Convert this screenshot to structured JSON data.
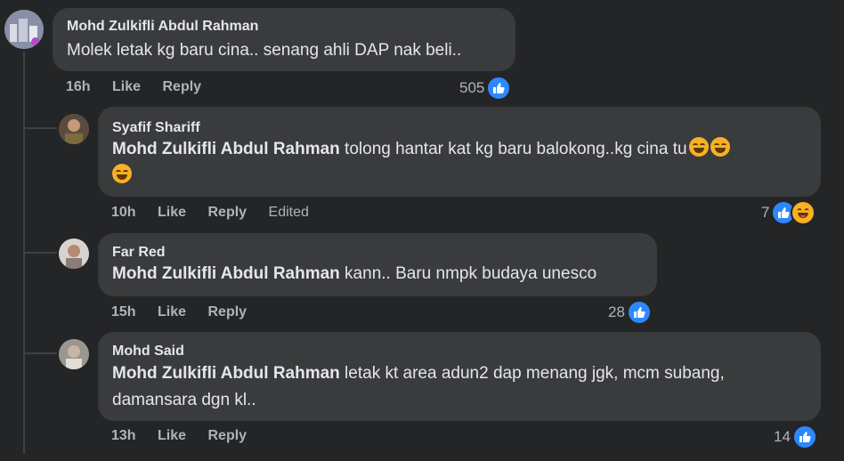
{
  "comments": [
    {
      "author": "Mohd Zulkifli Abdul Rahman",
      "text": "Molek letak kg baru cina.. senang ahli DAP nak beli..",
      "time": "16h",
      "like": "Like",
      "reply": "Reply",
      "reaction_count": "505"
    },
    {
      "author": "Syafif Shariff",
      "mention": "Mohd Zulkifli Abdul Rahman",
      "text": " tolong hantar kat kg baru balokong..kg cina tu",
      "time": "10h",
      "like": "Like",
      "reply": "Reply",
      "edited": "Edited",
      "reaction_count": "7"
    },
    {
      "author": "Far Red",
      "mention": "Mohd Zulkifli Abdul Rahman",
      "text": " kann.. Baru nmpk budaya unesco",
      "time": "15h",
      "like": "Like",
      "reply": "Reply",
      "reaction_count": "28"
    },
    {
      "author": "Mohd Said",
      "mention": "Mohd Zulkifli Abdul Rahman",
      "text": " letak kt area adun2 dap menang jgk, mcm subang, damansara dgn kl..",
      "time": "13h",
      "like": "Like",
      "reply": "Reply",
      "reaction_count": "14"
    }
  ],
  "icons": {
    "like": "like-reaction-icon",
    "haha": "haha-reaction-icon",
    "rofl": "rolling-laughing-emoji"
  },
  "colors": {
    "background": "#242526",
    "bubble": "#3a3b3c",
    "like_blue": "#2d88ff",
    "haha_yellow": "#f7b125"
  }
}
